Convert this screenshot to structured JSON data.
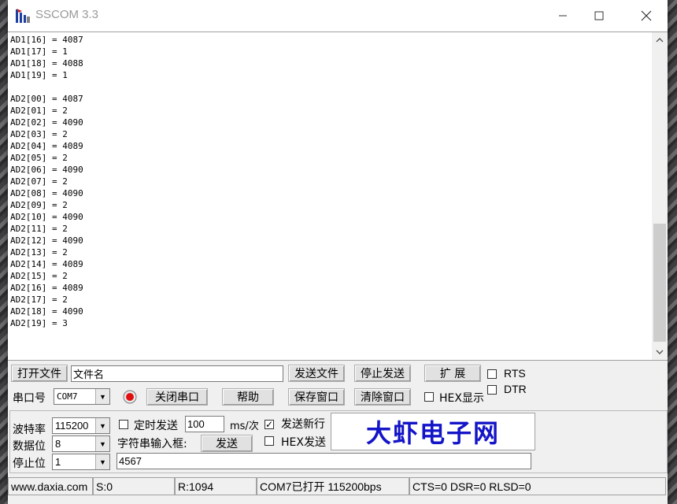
{
  "window": {
    "title": "SSCOM 3.3",
    "controls": {
      "minimize": "—",
      "maximize": "☐",
      "close": "✕"
    }
  },
  "terminal": {
    "lines": [
      "AD1[16] = 4087",
      "AD1[17] = 1",
      "AD1[18] = 4088",
      "AD1[19] = 1",
      "",
      "AD2[00] = 4087",
      "AD2[01] = 2",
      "AD2[02] = 4090",
      "AD2[03] = 2",
      "AD2[04] = 4089",
      "AD2[05] = 2",
      "AD2[06] = 4090",
      "AD2[07] = 2",
      "AD2[08] = 4090",
      "AD2[09] = 2",
      "AD2[10] = 4090",
      "AD2[11] = 2",
      "AD2[12] = 4090",
      "AD2[13] = 2",
      "AD2[14] = 4089",
      "AD2[15] = 2",
      "AD2[16] = 4089",
      "AD2[17] = 2",
      "AD2[18] = 4090",
      "AD2[19] = 3"
    ],
    "scroll_up": "⌃",
    "scroll_down": "⌄"
  },
  "toolbar": {
    "open_file": "打开文件",
    "filename_value": "文件名",
    "send_file": "发送文件",
    "stop_send": "停止发送",
    "expand": "扩 展",
    "rts_label": "RTS",
    "dtr_label": "DTR",
    "port_label": "串口号",
    "port_value": "COM7",
    "close_port": "关闭串口",
    "help": "帮助",
    "save_window": "保存窗口",
    "clear_window": "清除窗口",
    "hex_display": "HEX显示"
  },
  "settings": {
    "baud_label": "波特率",
    "baud_value": "115200",
    "databits_label": "数据位",
    "databits_value": "8",
    "stopbits_label": "停止位",
    "stopbits_value": "1",
    "timed_send_label": "定时发送",
    "interval_value": "100",
    "interval_unit": "ms/次",
    "send_newline_label": "发送新行",
    "send_newline_checked": "✓",
    "input_label": "字符串输入框:",
    "send_button": "发送",
    "hex_send_label": "HEX发送",
    "send_text_value": "4567"
  },
  "brand": {
    "text": "大虾电子网",
    "color": "#1414c8"
  },
  "status": {
    "website": "www.daxia.com",
    "sent": "S:0",
    "received": "R:1094",
    "port_status": "COM7已打开  115200bps",
    "lines": "CTS=0 DSR=0 RLSD=0"
  }
}
